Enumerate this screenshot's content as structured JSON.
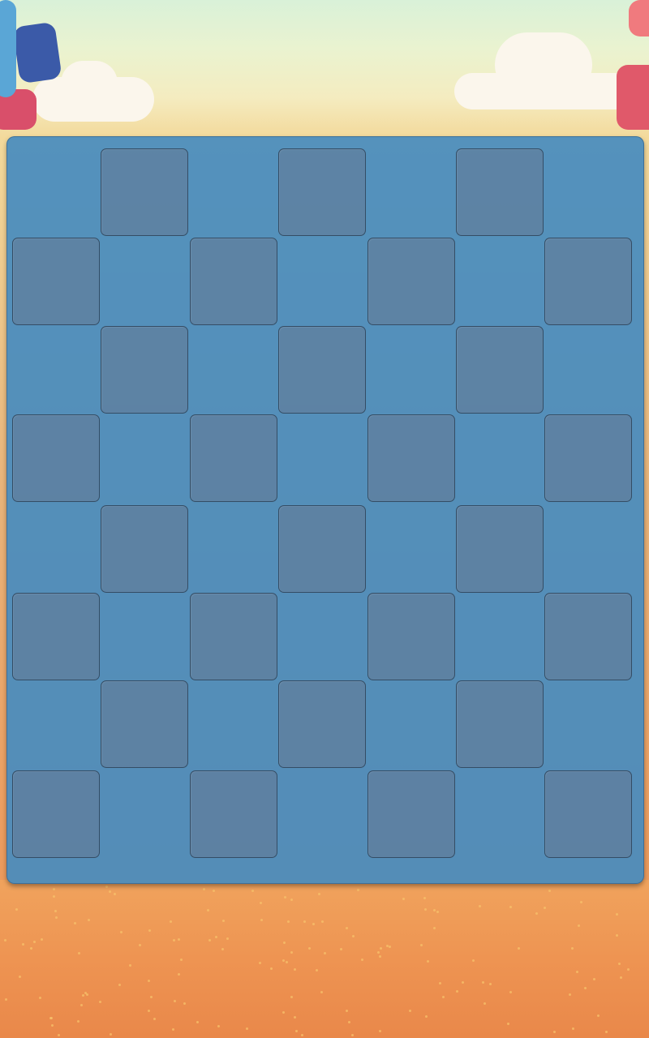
{
  "game": {
    "board": {
      "rows": 8,
      "columns": 7,
      "pattern": "checkerboard",
      "tile_color": "#5d7f9c",
      "board_color": "#4f8fbf"
    },
    "colors": {
      "sky": "#eaf3d0",
      "ground": "#ee9452",
      "totem_left": "#3b6fae",
      "totem_right": "#d9535f"
    }
  }
}
